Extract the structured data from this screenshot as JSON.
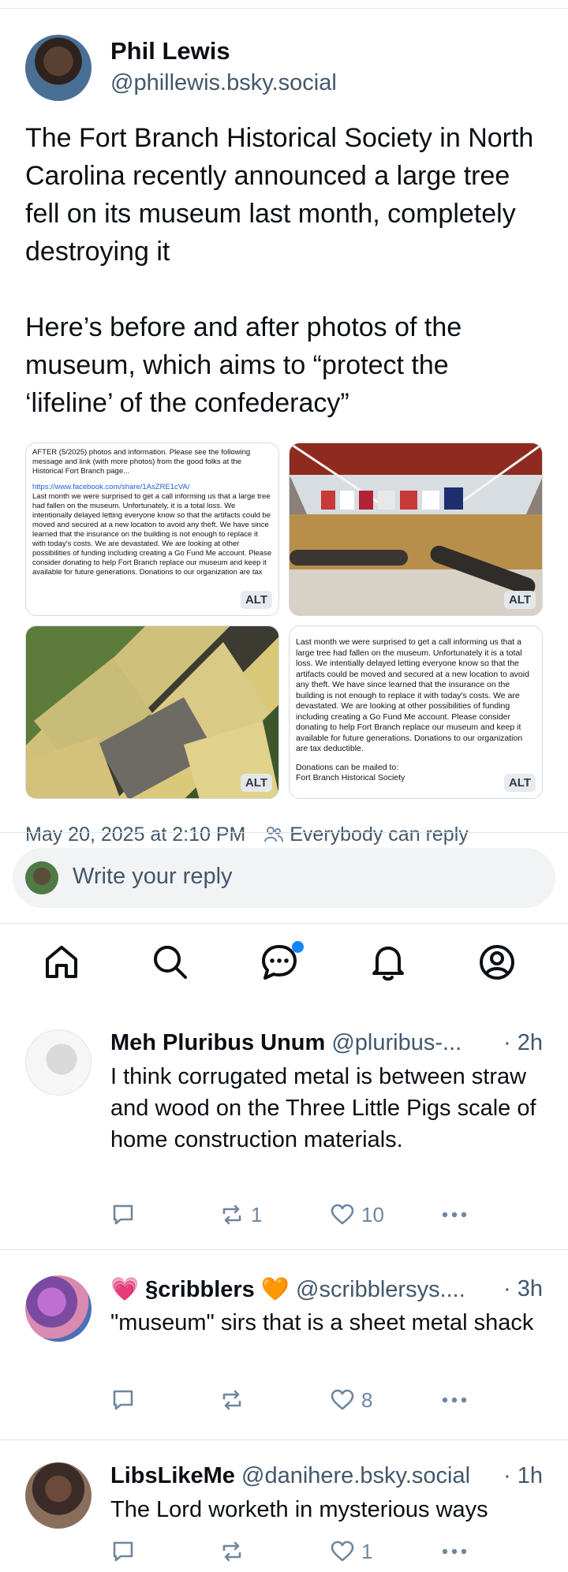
{
  "post": {
    "author_name": "Phil Lewis",
    "author_handle": "@phillewis.bsky.social",
    "text": "The Fort Branch Historical Society in North Carolina recently announced a large tree fell on its museum last month, completely destroying it\n\nHere’s before and after photos of the museum, which aims to “protect the ‘lifeline’ of the confederacy”",
    "images": [
      {
        "alt_badge": "ALT",
        "text_lines": "AFTER (5/2025) photos and information.  Please see the following message and link (with more photos) from the good folks at the Historical Fort Branch page...",
        "link": "https://www.facebook.com/share/1AsZRE1cVA/",
        "body": "Last month we were surprised to get a call informing us that a large tree had fallen on the museum. Unfortunately, it is a total loss. We intentionally delayed letting everyone know so that the artifacts could be moved and secured at a new location to avoid any theft. We have since learned that the insurance on the building is not enough to replace it with today's costs. We are devastated. We are looking at other possibilities of funding including creating a Go Fund Me account. Please consider donating to help Fort Branch replace our museum and keep it available for future generations. Donations to our organization are tax"
      },
      {
        "alt_badge": "ALT"
      },
      {
        "alt_badge": "ALT"
      },
      {
        "alt_badge": "ALT",
        "body": "Last month we were surprised to get a call informing us that a large tree had fallen on the museum. Unfortunately it is a total loss. We intentially delayed letting everyone know so that the artifacts could be moved and secured at a new location to avoid any theft. We have since learned that the insurance on the building is not enough to replace it with today's costs. We are devastated. We are looking at other possibilities of funding including creating a Go Fund Me account. Please consider donating to help Fort Branch replace our museum and keep it available for future generations. Donations to our organization are tax deductible.",
        "footer": "Donations can be mailed to:",
        "footer2": "Fort Branch Historical Society"
      }
    ],
    "timestamp": "May 20, 2025 at 2:10 PM",
    "reply_setting": "Everybody can reply"
  },
  "composer": {
    "placeholder": "Write your reply"
  },
  "tabs": [
    "home-icon",
    "search-icon",
    "chat-icon",
    "bell-icon",
    "profile-icon"
  ],
  "replies": [
    {
      "name": "Meh Pluribus Unum",
      "handle": "@pluribus-...",
      "time": "· 2h",
      "text": "I think corrugated metal is between straw and wood on the Three Little Pigs scale of home construction materials.",
      "reposts": "1",
      "likes": "10"
    },
    {
      "name_prefix": "💗",
      "name": "§cribblers",
      "name_suffix": "🧡",
      "handle": "@scribblersys....",
      "time": "· 3h",
      "text": "\"museum\" sirs that is a sheet metal shack",
      "reposts": "",
      "likes": "8"
    },
    {
      "name": "LibsLikeMe",
      "handle": "@danihere.bsky.social",
      "time": "· 1h",
      "text": "The Lord worketh in mysterious ways",
      "reposts": "",
      "likes": "1"
    }
  ],
  "colors": {
    "accent": "#1185fe",
    "muted": "#42576c",
    "icon": "#6f869f"
  }
}
